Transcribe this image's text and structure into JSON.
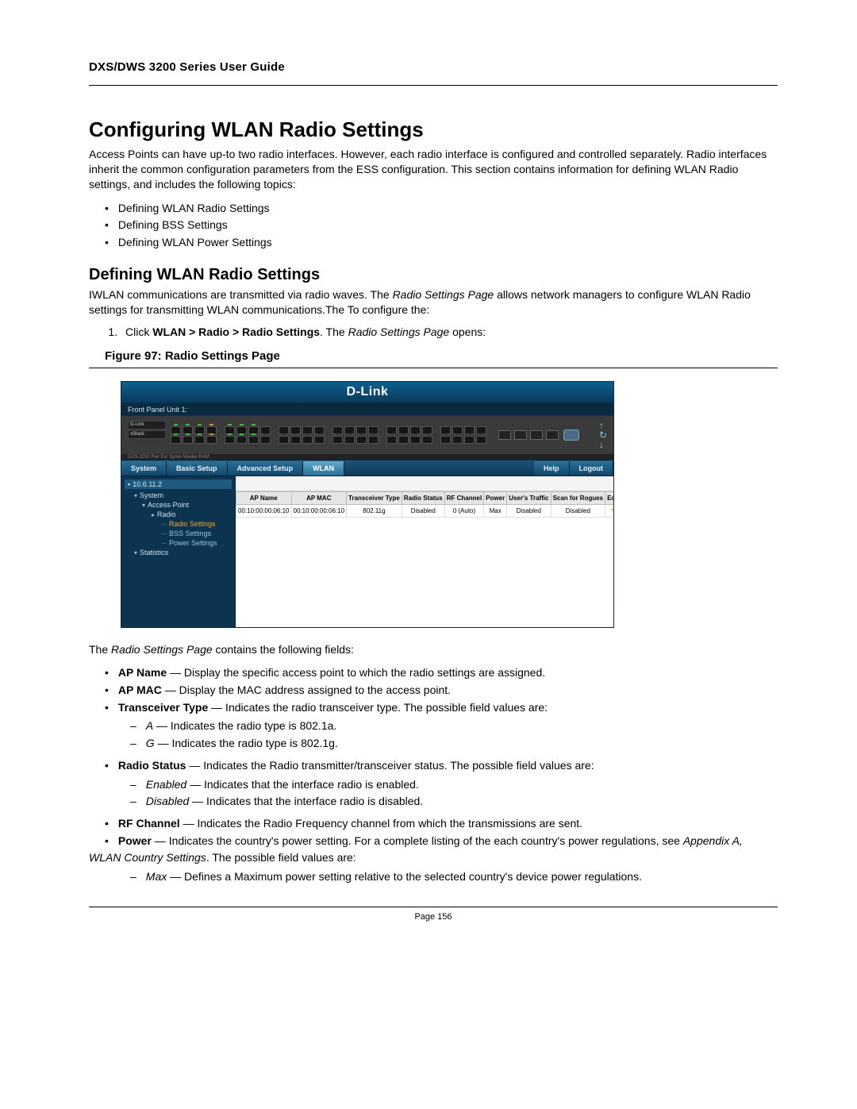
{
  "header": {
    "doc_title": "DXS/DWS 3200 Series User Guide"
  },
  "h1": "Configuring WLAN Radio Settings",
  "intro_para": "Access Points can have up-to two radio interfaces. However, each radio interface is configured and controlled separately. Radio interfaces inherit the common configuration parameters from the ESS configuration. This section contains information for defining WLAN Radio settings, and includes the following topics:",
  "topic_bullets": [
    "Defining WLAN Radio Settings",
    "Defining BSS Settings",
    "Defining WLAN Power Settings"
  ],
  "h2": "Defining WLAN Radio Settings",
  "h2_para_pre": "IWLAN communications are transmitted via radio waves. The ",
  "h2_para_italic": "Radio Settings Page",
  "h2_para_post": " allows network managers to configure WLAN Radio settings for transmitting WLAN communications.The To configure the:",
  "step1_pre": "Click ",
  "step1_bold": "WLAN > Radio > Radio Settings",
  "step1_mid": ".  The ",
  "step1_italic": "Radio Settings Page",
  "step1_post": " opens:",
  "figure_caption": "Figure 97:  Radio Settings Page",
  "screenshot": {
    "logo": "D-Link",
    "front_panel": "Front Panel Unit 1:",
    "device_label_top": "D-Link",
    "device_label_mid": "xStack",
    "status_line": "DXS-3250   Pwr  Ext Spree   Master  RAM",
    "tabs": {
      "system": "System",
      "basic": "Basic Setup",
      "advanced": "Advanced Setup",
      "wlan": "WLAN",
      "help": "Help",
      "logout": "Logout"
    },
    "tree": {
      "ip": "10.6.11.2",
      "system": "System",
      "ap": "Access Point",
      "radio": "Radio",
      "radio_settings": "Radio Settings",
      "bss": "BSS Settings",
      "power": "Power Settings",
      "stats": "Statistics"
    },
    "table": {
      "headers": {
        "ap_name": "AP Name",
        "ap_mac": "AP MAC",
        "trans": "Transceiver Type",
        "radio_status": "Radio Status",
        "rf": "RF Channel",
        "power": "Power",
        "traffic": "User's Traffic",
        "scan": "Scan for Rogues",
        "edit": "Edit"
      },
      "row": {
        "ap_name": "00:10:00:00:06:10",
        "ap_mac": "00:10:00:00:06:10",
        "trans": "802.11g",
        "radio_status": "Disabled",
        "rf": "0 (Auto)",
        "power": "Max",
        "traffic": "Disabled",
        "scan": "Disabled",
        "edit": "✎"
      }
    }
  },
  "after_fig_pre": "The ",
  "after_fig_italic": "Radio Settings Page",
  "after_fig_post": " contains the following fields:",
  "fields": {
    "ap_name_b": "AP Name",
    "ap_name_t": " — Display the specific access point to which the radio settings are assigned.",
    "ap_mac_b": "AP MAC",
    "ap_mac_t": " — Display the MAC address assigned to the access point.",
    "trans_b": "Transceiver Type",
    "trans_t": " — Indicates the radio transceiver type. The possible field values are:",
    "trans_a_i": "A",
    "trans_a_t": " — Indicates the radio type is 802.1a.",
    "trans_g_i": "G",
    "trans_g_t": " — Indicates the radio type is 802.1g.",
    "rstat_b": "Radio Status",
    "rstat_t": " — Indicates the Radio transmitter/transceiver status. The possible field values are:",
    "rstat_en_i": "Enabled",
    "rstat_en_t": " — Indicates that the interface radio is enabled.",
    "rstat_dis_i": "Disabled",
    "rstat_dis_t": " — Indicates that the interface radio is disabled.",
    "rf_b": "RF Channel",
    "rf_t": " — Indicates the Radio Frequency channel from which the transmissions are sent.",
    "power_b": "Power",
    "power_t1": " — Indicates the country's power setting. For a complete listing of the each country's power regulations, see ",
    "power_i": "Appendix A, WLAN Country Settings",
    "power_t2": ". The possible field values are:",
    "power_max_i": "Max",
    "power_max_t": " — Defines a Maximum power setting relative to the selected country's device power regulations."
  },
  "page_no": "Page 156"
}
